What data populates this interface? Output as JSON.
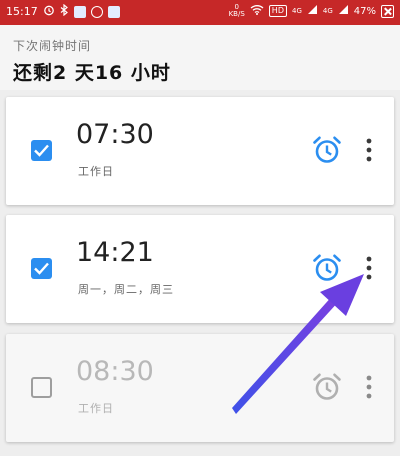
{
  "status_bar": {
    "time": "15:17",
    "network_speed_value": "0",
    "network_speed_unit": "KB/S",
    "hd_badge": "HD",
    "signal_1": "4G",
    "signal_2": "4G",
    "battery": "47%"
  },
  "header": {
    "label": "下次闹钟时间",
    "value": "还剩2 天16 小时"
  },
  "alarms": [
    {
      "time": "07:30",
      "days": "工作日",
      "enabled": true
    },
    {
      "time": "14:21",
      "days": "周一，周二，周三",
      "enabled": true
    },
    {
      "time": "08:30",
      "days": "工作日",
      "enabled": false
    }
  ],
  "colors": {
    "status_bar": "#c62828",
    "accent_blue": "#2b8ef0",
    "disabled_gray": "#b8b8b8",
    "annotation_arrow": "#6a3fe0"
  },
  "icons": {
    "alarm": "alarm-clock-icon",
    "more": "more-vert-icon",
    "check": "check-icon"
  }
}
